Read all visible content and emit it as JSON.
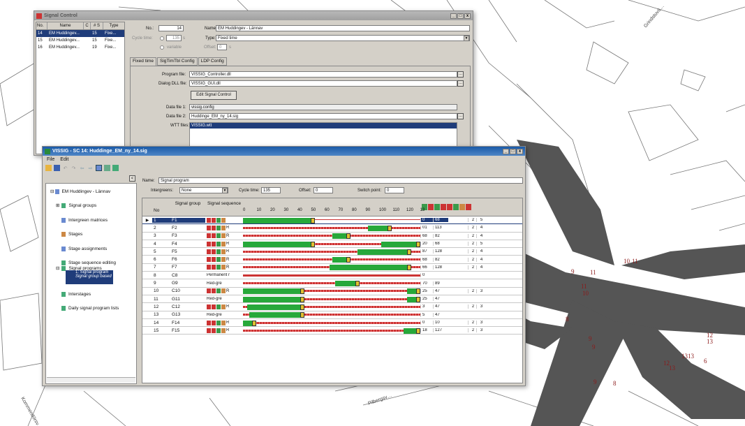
{
  "map": {
    "labels": [
      "Grindstuvä…",
      "Kommendörsv…",
      "Pilbergsv…",
      "10",
      "11",
      "11",
      "11",
      "10",
      "12",
      "13",
      "1313",
      "12",
      "13",
      "9",
      "9",
      "8",
      "9",
      "6",
      "8",
      "9"
    ]
  },
  "back": {
    "title": "Signal Control",
    "cols": [
      "No.",
      "Name",
      "C",
      "# S",
      "Type"
    ],
    "rows": [
      {
        "no": "14",
        "name": "EM Huddingev...",
        "s": "15",
        "type": "Fixe..."
      },
      {
        "no": "15",
        "name": "EM Huddingev...",
        "s": "15",
        "type": "Fixe..."
      },
      {
        "no": "16",
        "name": "EM Huddingev...",
        "s": "19",
        "type": "Fixe..."
      }
    ],
    "no_label": "No.:",
    "no_val": "14",
    "name_label": "Name:",
    "name_val": "EM Huddingev - Lännav",
    "cycle_label": "Cycle time:",
    "cycle_val": "135",
    "cycle_unit": "s",
    "variable": "variable",
    "type_label": "Type:",
    "type_val": "Fixed time",
    "offset_label": "Offset:",
    "offset_val": "0",
    "offset_unit": "s",
    "tabs": [
      "Fixed time",
      "SigTimTbl Config",
      "LDP Config"
    ],
    "prog_label": "Program file:",
    "prog_val": "VISSIG_Controller.dll",
    "dll_label": "Dialog DLL file:",
    "dll_val": "VISSIG_GUI.dll",
    "edit_btn": "Edit Signal Control",
    "d1_label": "Data file 1:",
    "d1_val": "vissig.config",
    "d2_label": "Data file 2:",
    "d2_val": "Huddinge_EM_ny_14.sig",
    "wtt_label": "WTT files:",
    "wtt_val": "VISSIG.wtt"
  },
  "front": {
    "title": "VISSIG - SC 14: Huddinge_EM_ny_14.sig",
    "menu": [
      "File",
      "Edit"
    ],
    "tree": {
      "root": "EM Huddingev - Lännav",
      "items": [
        "Signal groups",
        "Intergreen matrices",
        "Stages",
        "Stage assignments",
        "Stage sequence editing",
        "Signal programs"
      ],
      "selected": "1: Signal program",
      "selected_sub": "Signal group based",
      "after": [
        "Interstages",
        "Daily signal program lists"
      ]
    },
    "name_label": "Name:",
    "name_val": "Signal program",
    "ig_label": "Intergreens:",
    "ig_val": "None",
    "cycle_label": "Cycle time:",
    "cycle_val": "135",
    "offset_label": "Offset:",
    "offset_val": "0",
    "switch_label": "Switch point:",
    "switch_val": "0",
    "headers": {
      "no": "No",
      "sg": "Signal group",
      "seq": "Signal sequence"
    },
    "ticks": [
      "0",
      "10",
      "20",
      "30",
      "40",
      "50",
      "60",
      "70",
      "80",
      "90",
      "100",
      "110",
      "120",
      "13"
    ],
    "rows": [
      {
        "no": "1",
        "g": "F1",
        "s": "",
        "c1": "0",
        "c2": "68",
        "c3": "",
        "c4": "",
        "c5": "2",
        "c6": "5",
        "gs": 0,
        "ge": 55,
        "sel": true
      },
      {
        "no": "2",
        "g": "F2",
        "s": "R",
        "c1": "01",
        "c2": "113",
        "c3": "",
        "c4": "",
        "c5": "2",
        "c6": "4",
        "gs": 95,
        "ge": 113
      },
      {
        "no": "3",
        "g": "F3",
        "s": "R",
        "c1": "68",
        "c2": "82",
        "c3": "",
        "c4": "",
        "c5": "2",
        "c6": "4",
        "gs": 68,
        "ge": 82
      },
      {
        "no": "4",
        "g": "F4",
        "s": "R",
        "c1": "20",
        "c2": "68",
        "c3": "",
        "c4": "",
        "c5": "2",
        "c6": "5",
        "gs": 0,
        "ge": 55,
        "gs2": 105,
        "ge2": 135
      },
      {
        "no": "5",
        "g": "F5",
        "s": "R",
        "c1": "87",
        "c2": "128",
        "c3": "",
        "c4": "",
        "c5": "2",
        "c6": "4",
        "gs": 87,
        "ge": 128
      },
      {
        "no": "6",
        "g": "F6",
        "s": "R",
        "c1": "68",
        "c2": "82",
        "c3": "",
        "c4": "",
        "c5": "2",
        "c6": "4",
        "gs": 68,
        "ge": 82
      },
      {
        "no": "7",
        "g": "F7",
        "s": "R",
        "c1": "66",
        "c2": "128",
        "c3": "",
        "c4": "",
        "c5": "2",
        "c6": "4",
        "gs": 66,
        "ge": 128
      },
      {
        "no": "8",
        "g": "C8",
        "s": "Permanent r",
        "c1": "0",
        "c2": "",
        "c3": "",
        "c4": "",
        "c5": "",
        "c6": ""
      },
      {
        "no": "9",
        "g": "G9",
        "s": "Red-gre",
        "c1": "70",
        "c2": "89",
        "c3": "",
        "c4": "",
        "c5": "",
        "c6": "",
        "gs": 70,
        "ge": 89
      },
      {
        "no": "10",
        "g": "C10",
        "s": "R",
        "c1": "25",
        "c2": "47",
        "c3": "",
        "c4": "",
        "c5": "2",
        "c6": "3",
        "gs": 0,
        "ge": 47,
        "gs2": 125,
        "ge2": 135
      },
      {
        "no": "11",
        "g": "G11",
        "s": "Red-gre",
        "c1": "25",
        "c2": "47",
        "c3": "",
        "c4": "",
        "c5": "",
        "c6": "",
        "gs": 0,
        "ge": 47,
        "gs2": 125,
        "ge2": 135
      },
      {
        "no": "12",
        "g": "C12",
        "s": "R",
        "c1": "3",
        "c2": "47",
        "c3": "",
        "c4": "",
        "c5": "2",
        "c6": "3",
        "gs": 3,
        "ge": 47
      },
      {
        "no": "13",
        "g": "G13",
        "s": "Red-gre",
        "c1": "5",
        "c2": "47",
        "c3": "",
        "c4": "",
        "c5": "",
        "c6": "",
        "gs": 5,
        "ge": 47
      },
      {
        "no": "14",
        "g": "F14",
        "s": "R",
        "c1": "0",
        "c2": "10",
        "c3": "",
        "c4": "",
        "c5": "2",
        "c6": "3",
        "gs": 0,
        "ge": 10
      },
      {
        "no": "15",
        "g": "F15",
        "s": "R",
        "c1": "18",
        "c2": "127",
        "c3": "",
        "c4": "",
        "c5": "2",
        "c6": "3",
        "gs": 122,
        "ge": 135
      }
    ]
  }
}
